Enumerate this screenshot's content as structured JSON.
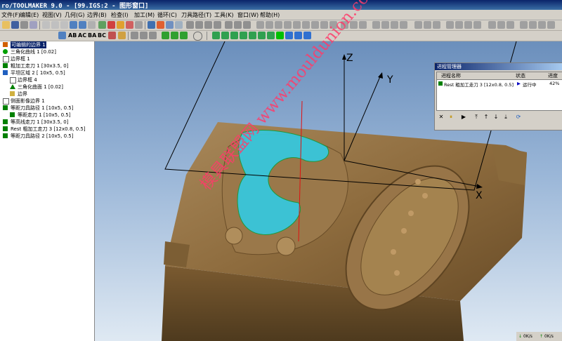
{
  "title": "ro/TOOLMAKER 9.0 - [99.IGS:2 - 图形窗口]",
  "menu": [
    "文件(F)",
    "编辑(E)",
    "视图(V)",
    "几何(G)",
    "边界(B)",
    "检查(I)",
    "加工(M)",
    "循环(C)",
    "刀具路径(T)",
    "工具(K)",
    "窗口(W)",
    "帮助(H)"
  ],
  "toolbar2_labels": [
    "AB",
    "AC",
    "BA",
    "BC"
  ],
  "tree": [
    {
      "label": "可编辑的边界 1",
      "icon": "boundary-icon",
      "color": "#d06000",
      "selected": true
    },
    {
      "label": "三角化曲线 1 [0.02]",
      "icon": "curve-icon",
      "color": "#00a000"
    },
    {
      "label": "边界框 1",
      "icon": "box-icon",
      "color": "#606060"
    },
    {
      "label": "粗加工走刀 1 [30x3.5, 0]",
      "icon": "toolpath-icon",
      "color": "#008000"
    },
    {
      "label": "平坦区域 2 [ 10x5, 0.5]",
      "icon": "flat-area-icon",
      "color": "#2060c0"
    },
    {
      "label": "边界框 4",
      "icon": "box-icon",
      "color": "#606060"
    },
    {
      "label": "三角化曲面 1 [0.02]",
      "icon": "surface-icon",
      "color": "#008000"
    },
    {
      "label": "边界",
      "icon": "folder-icon",
      "color": "#d0b040"
    },
    {
      "label": "侧面影像边界 1",
      "icon": "boundary-icon",
      "color": "#606060"
    },
    {
      "label": "等距刀具路径 1 [10x5, 0.5]",
      "icon": "toolpath-icon",
      "color": "#008000"
    },
    {
      "label": "等距走刀 1 [10x5, 0.5]",
      "icon": "toolpath-icon",
      "color": "#008000"
    },
    {
      "label": "等高线走刀 1 [30x3.5, 0]",
      "icon": "toolpath-icon",
      "color": "#008000"
    },
    {
      "label": "Rest 粗加工走刀 3 [12x0.8, 0.5]",
      "icon": "toolpath-icon",
      "color": "#008000"
    },
    {
      "label": "等距刀具路径 2 [10x5, 0.5]",
      "icon": "toolpath-icon",
      "color": "#008000"
    }
  ],
  "axes": {
    "x": "X",
    "y": "Y",
    "z": "Z"
  },
  "watermark": "模具联盟网 www.mouldunion.com",
  "process_manager": {
    "title": "进程管理器",
    "columns": [
      "进程名称",
      "状态",
      "进度"
    ],
    "rows": [
      {
        "name": "Rest 粗加工走刀 3 [12x0.8, 0.5]",
        "status": "运行中",
        "progress": "42%"
      }
    ],
    "buttons": [
      "✕",
      "⏸",
      "▶",
      "⤒",
      "↑",
      "↓",
      "⤓",
      "⟳"
    ]
  },
  "status": {
    "down": "0K/s",
    "up": "0K/s"
  }
}
